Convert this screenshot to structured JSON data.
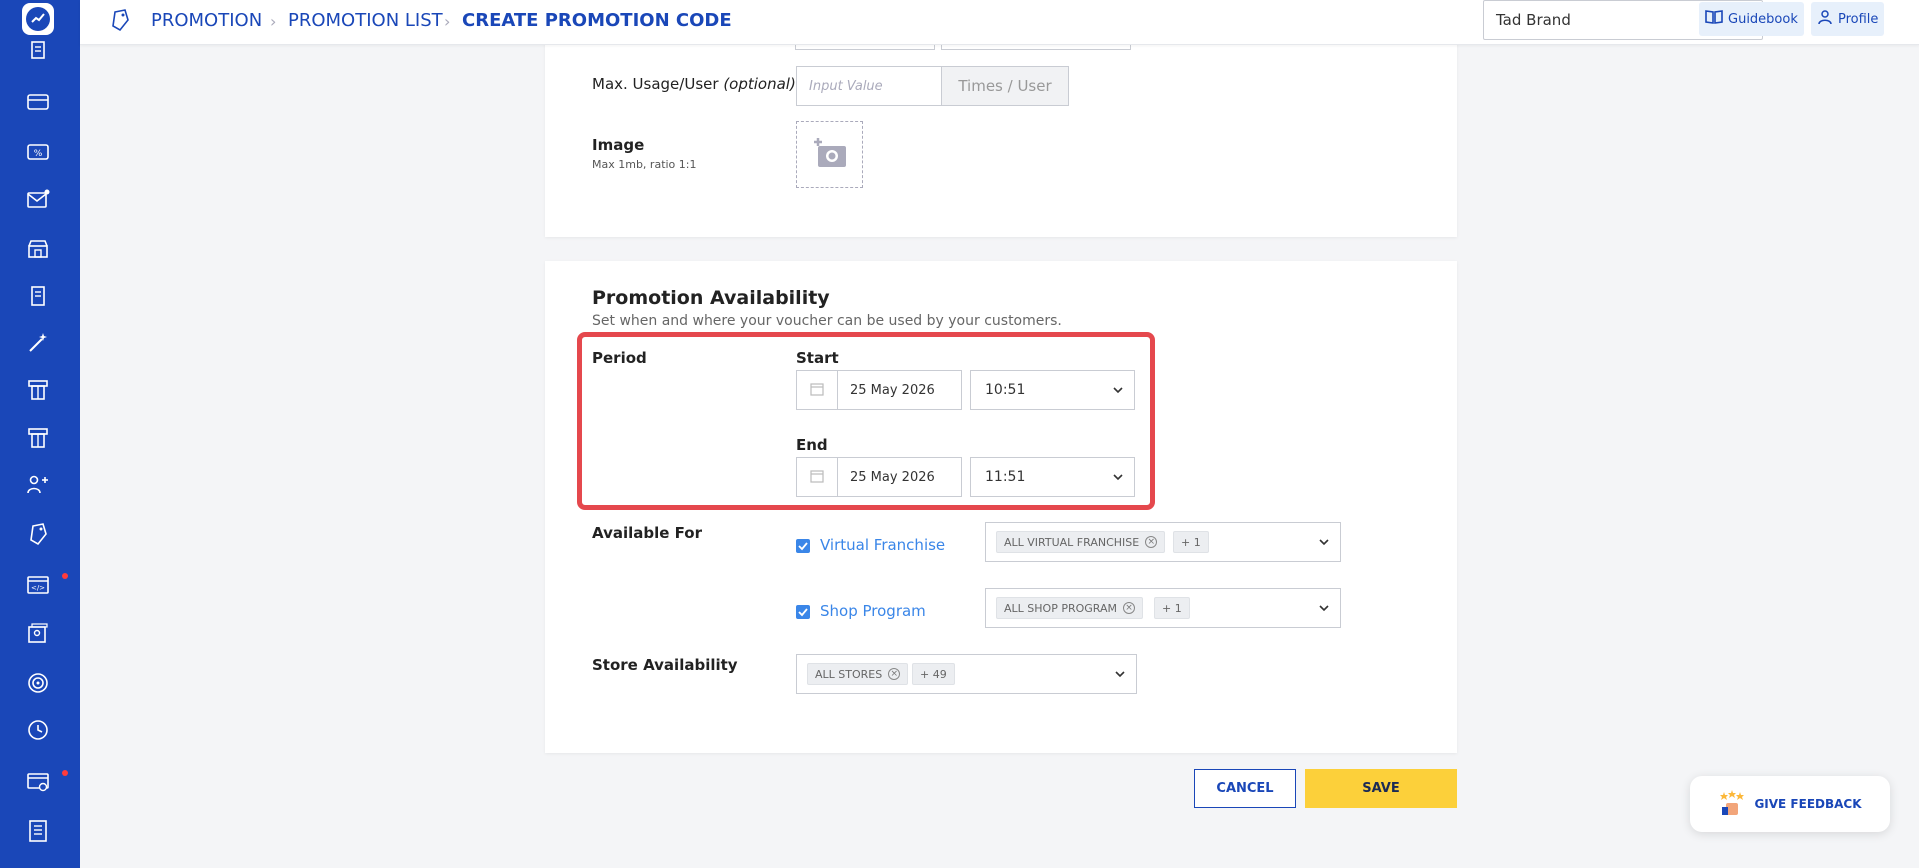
{
  "header": {
    "breadcrumb": [
      "PROMOTION",
      "PROMOTION LIST",
      "CREATE PROMOTION CODE"
    ],
    "brand_select": "Tad Brand",
    "guidebook_label": "Guidebook",
    "profile_label": "Profile"
  },
  "details": {
    "max_usage_label": "Max. Usage/User",
    "max_usage_optional": "(optional)",
    "max_usage_placeholder": "Input Value",
    "max_usage_suffix": "Times / User",
    "image_label": "Image",
    "image_hint": "Max 1mb, ratio 1:1"
  },
  "availability": {
    "title": "Promotion Availability",
    "description": "Set when and where your voucher can be used by your customers.",
    "period_label": "Period",
    "start_label": "Start",
    "start_date": "25 May 2026",
    "start_time": "10:51",
    "end_label": "End",
    "end_date": "25 May 2026",
    "end_time": "11:51",
    "available_for_label": "Available For",
    "virtual_franchise_label": "Virtual Franchise",
    "virtual_franchise_tag": "ALL VIRTUAL FRANCHISE",
    "virtual_franchise_more": "+ 1",
    "shop_program_label": "Shop Program",
    "shop_program_tag": "ALL SHOP PROGRAM",
    "shop_program_more": "+ 1",
    "store_availability_label": "Store Availability",
    "stores_tag": "ALL STORES",
    "stores_more": "+ 49"
  },
  "actions": {
    "cancel_label": "CANCEL",
    "save_label": "SAVE",
    "feedback_label": "GIVE FEEDBACK"
  },
  "colors": {
    "sidebar": "#1a47b8",
    "accent": "#1a47b8",
    "save": "#fcd03a",
    "highlight": "#e5484d",
    "checkbox": "#3a86e8"
  }
}
